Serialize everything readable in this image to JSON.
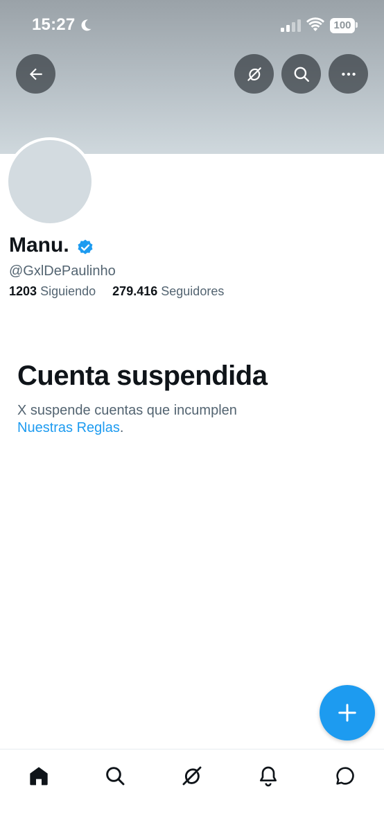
{
  "status_bar": {
    "time": "15:27",
    "battery_level": "100",
    "icons": [
      "moon-icon",
      "signal-icon",
      "wifi-icon",
      "battery-icon"
    ]
  },
  "header_buttons": {
    "back": "arrow-left-icon",
    "grok": "grok-icon",
    "search": "search-icon",
    "more": "more-icon"
  },
  "profile": {
    "display_name": "Manu.",
    "handle": "@GxlDePaulinho",
    "following_count": "1203",
    "following_label": "Siguiendo",
    "followers_count": "279.416",
    "followers_label": "Seguidores",
    "verified_color": "#1d9bf0"
  },
  "suspension": {
    "title": "Cuenta suspendida",
    "text": "X suspende cuentas que incumplen",
    "link_text": "Nuestras Reglas",
    "trailing": "."
  },
  "fab": {
    "icon": "plus-icon"
  },
  "bottom_nav": [
    "home-icon",
    "search-icon",
    "grok-icon",
    "notifications-icon",
    "messages-icon"
  ],
  "colors": {
    "accent": "#1d9bf0",
    "primary_text": "#0f1419",
    "secondary_text": "#536471",
    "avatar_placeholder": "#d3dbe0"
  }
}
